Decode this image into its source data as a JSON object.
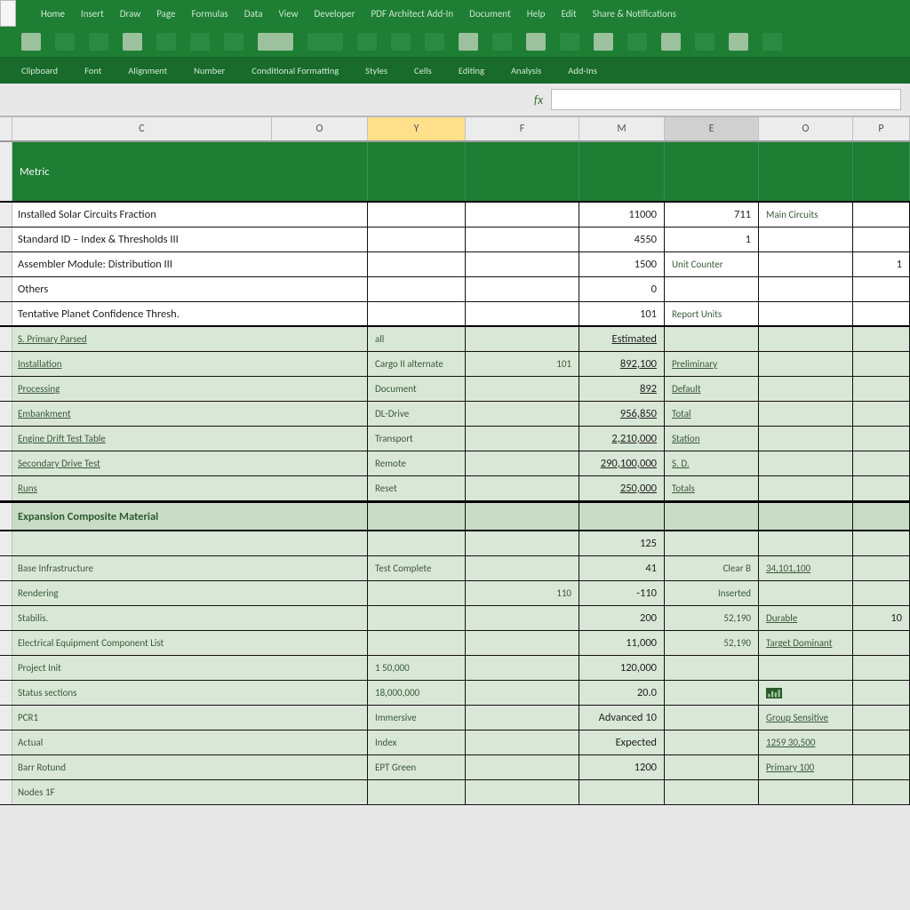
{
  "ribbon": {
    "tabs": [
      "Home",
      "Insert",
      "Draw",
      "Page",
      "Formulas",
      "Data",
      "View",
      "Developer",
      "PDF Architect Add-In",
      "Document",
      "Help",
      "Edit",
      "Share & Notifications"
    ],
    "subbar": [
      "Clipboard",
      "Font",
      "Alignment",
      "Number",
      "Conditional Formatting",
      "Styles",
      "Cells",
      "Editing",
      "Analysis",
      "Add-Ins"
    ]
  },
  "formula_bar": {
    "fx": "fx",
    "value": ""
  },
  "columns": [
    "C",
    "O",
    "Y",
    "F",
    "M",
    "E",
    "O",
    "P"
  ],
  "table_header": {
    "c0": "Metric"
  },
  "rows_top": [
    {
      "a": "Installed Solar Circuits Fraction",
      "m": "11000",
      "o": "711",
      "p": "Main Circuits"
    },
    {
      "a": "Standard ID – Index & Thresholds III",
      "m": "4550",
      "o": "1",
      "p": ""
    },
    {
      "a": "Assembler Module: Distribution III",
      "m": "1500",
      "o": "Unit Counter",
      "p": "1"
    },
    {
      "a": "Others",
      "m": "0",
      "o": "",
      "p": ""
    },
    {
      "a": "Tentative Planet Confidence Thresh.",
      "m": "101",
      "o": "Report Units",
      "p": ""
    }
  ],
  "section_green": [
    {
      "a": "S. Primary Parsed",
      "y": "all",
      "f": "",
      "m": "Estimated",
      "o": ""
    },
    {
      "a": "Installation",
      "y": "Cargo II alternate",
      "f": "101",
      "m": "892,100",
      "o": "Preliminary"
    },
    {
      "a": "Processing",
      "y": "Document",
      "f": "",
      "m": "892",
      "o": "Default"
    },
    {
      "a": "Embankment",
      "y": "DL-Drive",
      "f": "",
      "m": "956,850",
      "o": "Total"
    },
    {
      "a": "Engine Drift Test Table",
      "y": "Transport",
      "f": "",
      "m": "2,210,000",
      "o": "Station"
    },
    {
      "a": "Secondary Drive Test",
      "y": "Remote",
      "f": "",
      "m": "290,100,000",
      "o": "S. D."
    },
    {
      "a": "Runs",
      "y": "Reset",
      "f": "",
      "m": "250,000",
      "o": "Totals"
    }
  ],
  "section_header_2": "Expansion Composite Material",
  "rows_mid": [
    {
      "a": "",
      "y": "",
      "f": "",
      "m": "125",
      "e": "",
      "o": ""
    }
  ],
  "rows_bottom": [
    {
      "a": "Base Infrastructure",
      "y": "Test   Complete",
      "f": "",
      "m": "41",
      "e": "Clear B",
      "o": "34,101,100"
    },
    {
      "a": "Rendering",
      "y": "",
      "f": "110",
      "m": "-110",
      "e": "Inserted",
      "o": ""
    },
    {
      "a": "Stabilis.",
      "y": "",
      "f": "",
      "m": "200",
      "e": "52,190",
      "o": "Durable",
      "p": "10"
    },
    {
      "a": "Electrical Equipment Component List",
      "y": "",
      "f": "",
      "m": "11,000",
      "e": "52,190",
      "o": "Target Dominant",
      "p": ""
    },
    {
      "a": "Project   Init",
      "y": "1 50,000",
      "f": "",
      "m": "120,000",
      "e": "",
      "o": "",
      "p": ""
    },
    {
      "a": "       Status sections",
      "y": "18,000,000",
      "f": "",
      "m": "20.0",
      "e": "",
      "o": "icon",
      "p": ""
    },
    {
      "a": "PCR1",
      "y": "Immersive",
      "f": "",
      "m": "Advanced 10",
      "e": "",
      "o": "Group Sensitive",
      "p": ""
    },
    {
      "a": "Actual",
      "y": "Index",
      "f": "",
      "m": "Expected",
      "e": "",
      "o": "1259 30,500",
      "p": ""
    },
    {
      "a": "Barr Rotund",
      "y": "EPT Green",
      "f": "",
      "m": "1200",
      "e": "",
      "o": "Primary 100",
      "p": ""
    },
    {
      "a": "Nodes 1F",
      "y": "",
      "f": "",
      "m": "",
      "e": "",
      "o": "",
      "p": ""
    }
  ],
  "colors": {
    "ribbon": "#1e7e34",
    "ribbon_dark": "#186a2a",
    "green_fill": "#d9e7d6",
    "green_sh": "#c9ddc6",
    "sel": "#ffe08a"
  }
}
